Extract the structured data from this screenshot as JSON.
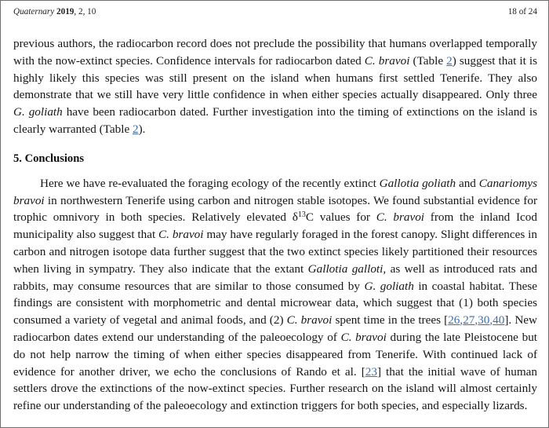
{
  "header": {
    "journal": "Quaternary",
    "year": "2019",
    "volume_issue": ", 2, 10",
    "page_indicator": "18 of 24"
  },
  "sections": {
    "paragraph_1": {
      "seg_1": "previous authors, the radiocarbon record does not preclude the possibility that humans overlapped temporally with the now-extinct species. Confidence intervals for radiocarbon dated ",
      "species_1": "C. bravoi",
      "seg_2": " (Table ",
      "link_1": "2",
      "seg_3": ") suggest that it is highly likely this species was still present on the island when humans first settled Tenerife. They also demonstrate that we still have very little confidence in when either species actually disappeared. Only three ",
      "species_2": "G. goliath",
      "seg_4": " have been radiocarbon dated. Further investigation into the timing of extinctions on the island is clearly warranted (Table ",
      "link_2": "2",
      "seg_5": ")."
    },
    "conclusions_heading": "5. Conclusions",
    "paragraph_2": {
      "seg_1": "Here we have re-evaluated the foraging ecology of the recently extinct ",
      "species_1": "Gallotia goliath",
      "seg_2": " and ",
      "species_2": "Canariomys bravoi",
      "seg_3": " in northwestern Tenerife using carbon and nitrogen stable isotopes. We found substantial evidence for trophic omnivory in both species. Relatively elevated δ",
      "sup_1": "13",
      "seg_4": "C values for ",
      "species_3": "C. bravoi",
      "seg_5": " from the inland Icod municipality also suggest that ",
      "species_4": "C. bravoi",
      "seg_6": " may have regularly foraged in the forest canopy. Slight differences in carbon and nitrogen isotope data further suggest that the two extinct species likely partitioned their resources when living in sympatry. They also indicate that the extant ",
      "species_5": "Gallotia galloti",
      "seg_7": ", as well as introduced rats and rabbits, may consume resources that are similar to those consumed by ",
      "species_6": "G. goliath",
      "seg_8": " in coastal habitat. These findings are consistent with morphometric and dental microwear data, which suggest that (1) both species consumed a variety of vegetal and animal foods, and (2) ",
      "species_7": "C. bravoi",
      "seg_9": " spent time in the trees [",
      "link_1": "26",
      "sep_1": ",",
      "link_2": "27",
      "sep_2": ",",
      "link_3": "30",
      "sep_3": ",",
      "link_4": "40",
      "seg_10": "]. New radiocarbon dates extend our understanding of the paleoecology of ",
      "species_8": "C. bravoi",
      "seg_11": " during the late Pleistocene but do not help narrow the timing of when either species disappeared from Tenerife. With continued lack of evidence for another driver, we echo the conclusions of Rando et al. [",
      "link_5": "23",
      "seg_12": "] that the initial wave of human settlers drove the extinctions of the now-extinct species. Further research on the island will almost certainly refine our understanding of the paleoecology and extinction triggers for both species, and especially lizards."
    }
  },
  "colors": {
    "link": "#3b6ea8",
    "text": "#161616",
    "page_border": "#6f6f6f"
  }
}
